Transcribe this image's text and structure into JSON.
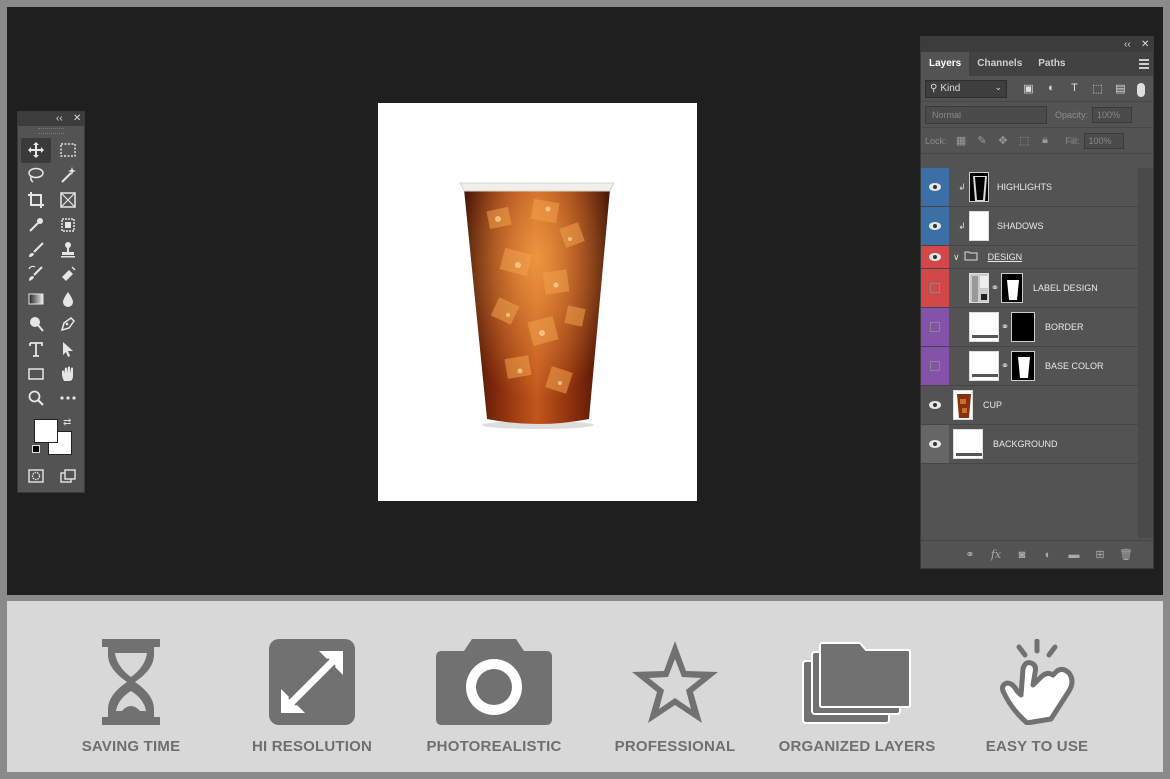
{
  "panels": {
    "toolbar_collapse": "‹‹",
    "close": "✕"
  },
  "tools": [
    {
      "name": "move-tool",
      "active": true
    },
    {
      "name": "rectangular-marquee-tool"
    },
    {
      "name": "lasso-tool"
    },
    {
      "name": "magic-wand-tool"
    },
    {
      "name": "crop-tool"
    },
    {
      "name": "frame-tool"
    },
    {
      "name": "eyedropper-tool"
    },
    {
      "name": "object-selection-tool"
    },
    {
      "name": "brush-tool"
    },
    {
      "name": "clone-stamp-tool"
    },
    {
      "name": "history-brush-tool"
    },
    {
      "name": "eraser-tool"
    },
    {
      "name": "gradient-tool"
    },
    {
      "name": "blur-tool"
    },
    {
      "name": "dodge-tool"
    },
    {
      "name": "pen-tool"
    },
    {
      "name": "type-tool"
    },
    {
      "name": "path-selection-tool"
    },
    {
      "name": "rectangle-tool"
    },
    {
      "name": "hand-tool"
    },
    {
      "name": "zoom-tool"
    },
    {
      "name": "more-tools"
    }
  ],
  "layers_panel": {
    "tabs": [
      "Layers",
      "Channels",
      "Paths"
    ],
    "active_tab": "Layers",
    "filter": "Kind",
    "blend_mode": "Normal",
    "opacity_label": "Opacity:",
    "opacity": "100%",
    "lock_label": "Lock:",
    "fill_label": "Fill:",
    "fill": "100%",
    "layers": [
      {
        "name": "HIGHLIGHTS",
        "visible": true,
        "color": "#3b6fa5",
        "clipped": true,
        "thumb": "dark-cup"
      },
      {
        "name": "SHADOWS",
        "visible": true,
        "color": "#3b6fa5",
        "clipped": true,
        "thumb": "white"
      },
      {
        "name": "DESIGN",
        "visible": true,
        "color": "#d2484a",
        "group": true
      },
      {
        "name": "LABEL DESIGN",
        "visible": false,
        "color": "#d2484a",
        "thumb": "smart",
        "mask": "cup-mask"
      },
      {
        "name": "BORDER",
        "visible": false,
        "color": "#8453a9",
        "thumb": "white",
        "mask": "black"
      },
      {
        "name": "BASE COLOR",
        "visible": false,
        "color": "#8453a9",
        "thumb": "white",
        "mask": "cup-mask"
      },
      {
        "name": "CUP",
        "visible": true,
        "color": "",
        "thumb": "cola"
      },
      {
        "name": "BACKGROUND",
        "visible": true,
        "color": "#666666",
        "thumb": "white"
      }
    ]
  },
  "features": [
    {
      "label": "SAVING TIME",
      "icon": "hourglass-icon"
    },
    {
      "label": "HI RESOLUTION",
      "icon": "expand-icon"
    },
    {
      "label": "PHOTOREALISTIC",
      "icon": "camera-icon"
    },
    {
      "label": "PROFESSIONAL",
      "icon": "star-icon"
    },
    {
      "label": "ORGANIZED LAYERS",
      "icon": "folders-icon"
    },
    {
      "label": "EASY TO USE",
      "icon": "tap-hand-icon"
    }
  ],
  "colors": {
    "workspace": "#1f1f1f",
    "panel": "#535353",
    "feature_strip": "#d8d8d8",
    "feature_icon": "#717171",
    "cola": "#7a2a0c"
  }
}
